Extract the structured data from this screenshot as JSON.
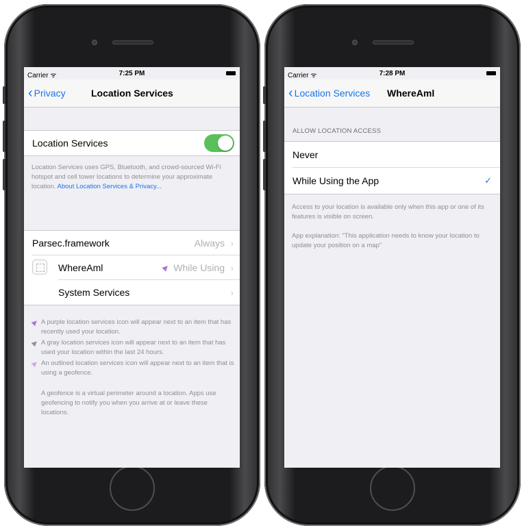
{
  "phones": [
    {
      "status": {
        "carrier": "Carrier ᯤ",
        "time": "7:25 PM"
      },
      "nav": {
        "back": "Privacy",
        "title": "Location Services"
      },
      "location_toggle": {
        "label": "Location Services",
        "on": true
      },
      "description": "Location Services uses GPS, Bluetooth, and crowd-sourced Wi-Fi hotspot and cell tower locations to determine your approximate location.",
      "description_link": "About Location Services & Privacy...",
      "apps": [
        {
          "name": "Parsec.framework",
          "detail": "Always"
        },
        {
          "name": "WhereAml",
          "detail": "While Using"
        },
        {
          "name": "System Services",
          "detail": ""
        }
      ],
      "legend": [
        {
          "icon": "purple-location-arrow-icon",
          "text": "A purple location services icon will appear next to an item that has recently used your location."
        },
        {
          "icon": "gray-location-arrow-icon",
          "text": "A gray location services icon will appear next to an item that has used your location within the last 24 hours."
        },
        {
          "icon": "outlined-location-arrow-icon",
          "text": "An outlined location services icon will appear next to an item that is using a geofence."
        }
      ],
      "geofence_note": "A geofence is a virtual perimeter around a location. Apps use geofencing to notify you when you arrive at or leave these locations."
    },
    {
      "status": {
        "carrier": "Carrier ᯤ",
        "time": "7:28 PM"
      },
      "nav": {
        "back": "Location Services",
        "title": "WhereAml"
      },
      "section_header": "ALLOW LOCATION ACCESS",
      "options": [
        {
          "label": "Never",
          "selected": false
        },
        {
          "label": "While Using the App",
          "selected": true
        }
      ],
      "footer1": "Access to your location is available only when this app or one of its features is visible on screen.",
      "footer2": "App explanation: \"This application needs to know your location to update your position on a map\""
    }
  ],
  "colors": {
    "accent": "#1a73e8",
    "toggle_on": "#5ac15a",
    "purple": "#a774d9"
  }
}
